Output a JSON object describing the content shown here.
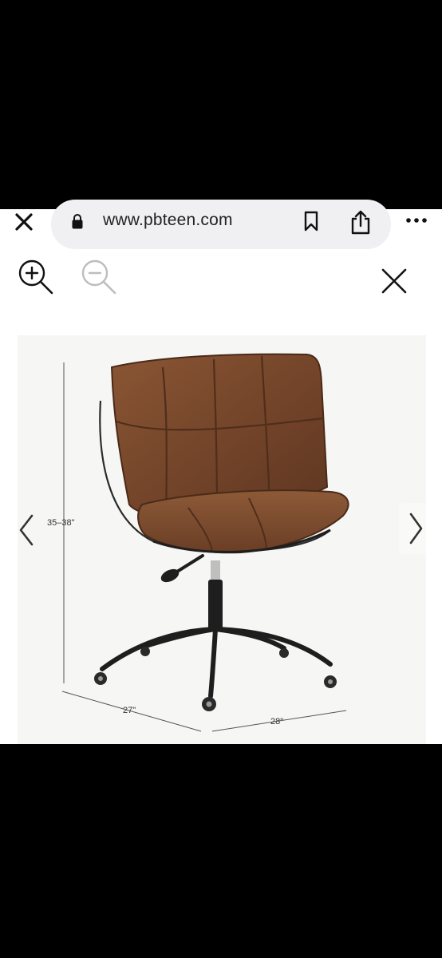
{
  "browser": {
    "url": "www.pbteen.com",
    "icons": {
      "close": "close-icon",
      "lock": "lock-icon",
      "bookmark": "bookmark-icon",
      "share": "share-icon",
      "more": "more-icon"
    }
  },
  "viewer": {
    "controls": {
      "zoom_in": "zoom-in-icon",
      "zoom_out": "zoom-out-icon",
      "close": "close-icon"
    },
    "dimensions": {
      "height": "35–38\"",
      "depth": "27\"",
      "width": "28\""
    },
    "navigation": {
      "prev": "chevron-left-icon",
      "next": "chevron-right-icon"
    }
  },
  "colors": {
    "leather": "#7a4a2c",
    "frame": "#1e1e1e",
    "background": "#f6f6f5"
  }
}
